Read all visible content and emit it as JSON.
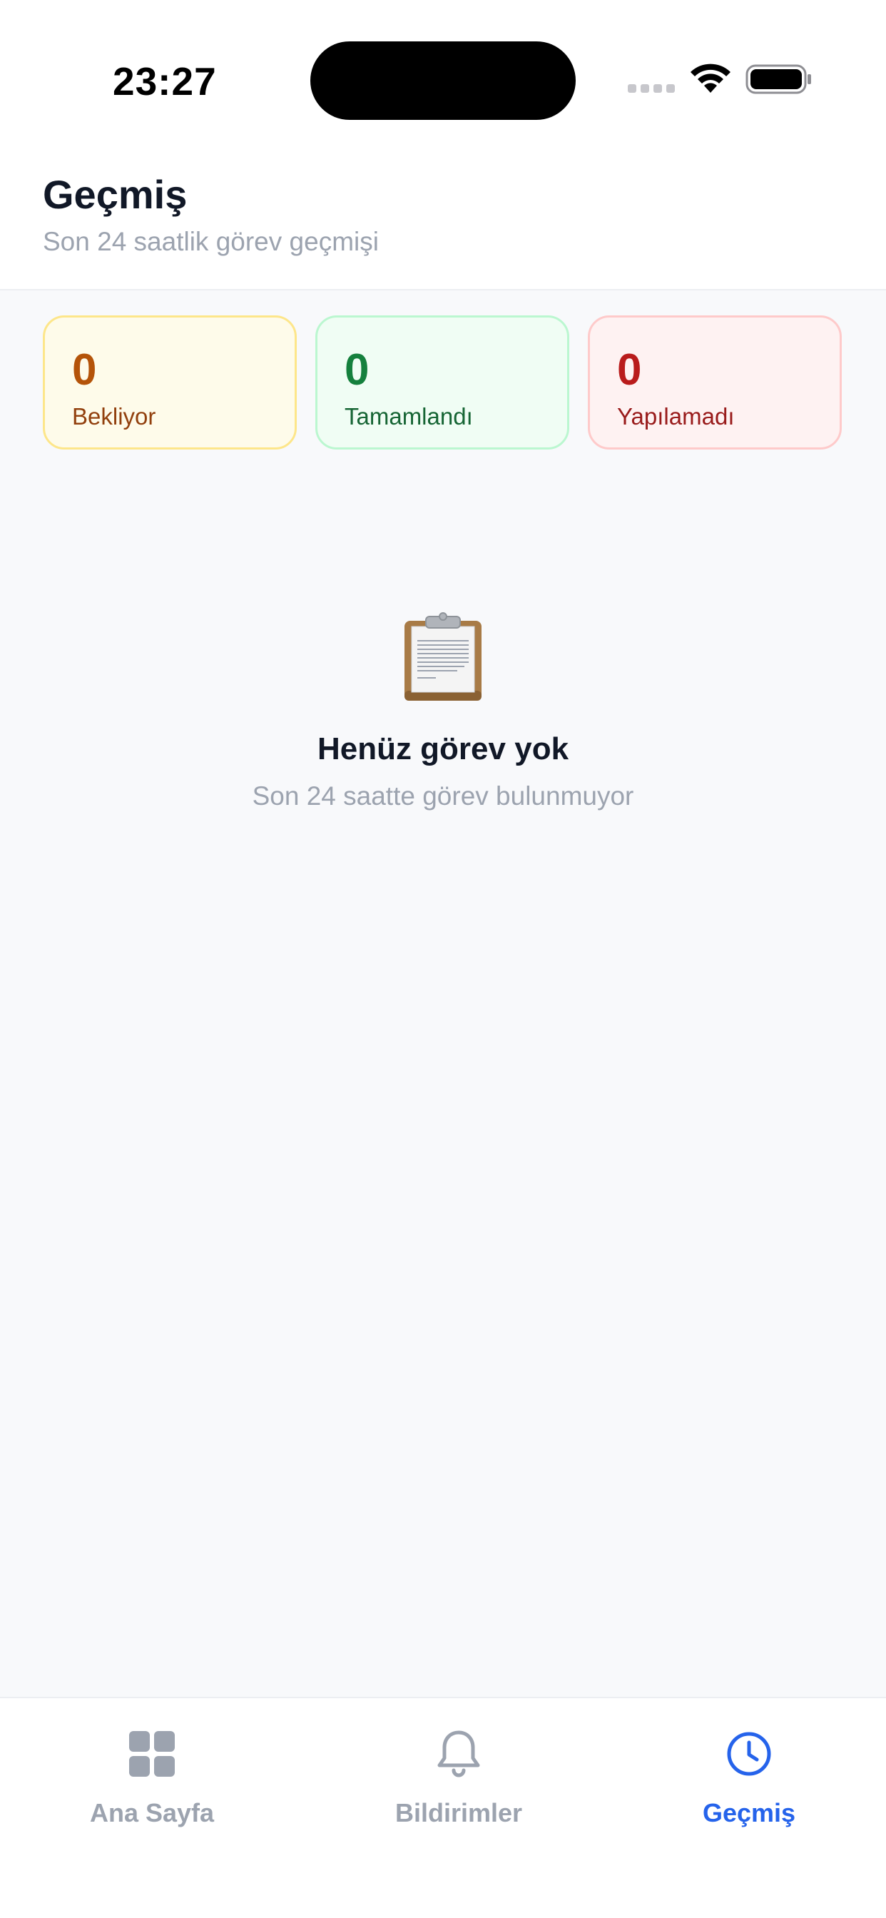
{
  "status_bar": {
    "time": "23:27"
  },
  "header": {
    "title": "Geçmiş",
    "subtitle": "Son 24 saatlik görev geçmişi"
  },
  "stats": [
    {
      "value": "0",
      "label": "Bekliyor",
      "color": "#b45309"
    },
    {
      "value": "0",
      "label": "Tamamlandı",
      "color": "#15803d"
    },
    {
      "value": "0",
      "label": "Yapılamadı",
      "color": "#b91c1c"
    }
  ],
  "empty_state": {
    "icon": "clipboard-icon",
    "title": "Henüz görev yok",
    "subtitle": "Son 24 saatte görev bulunmuyor"
  },
  "tab_bar": {
    "active_color": "#2563eb",
    "inactive_color": "#9ca3af",
    "tabs": [
      {
        "label": "Ana Sayfa",
        "icon": "grid-icon",
        "active": false
      },
      {
        "label": "Bildirimler",
        "icon": "bell-icon",
        "active": false
      },
      {
        "label": "Geçmiş",
        "icon": "clock-icon",
        "active": true
      }
    ]
  }
}
